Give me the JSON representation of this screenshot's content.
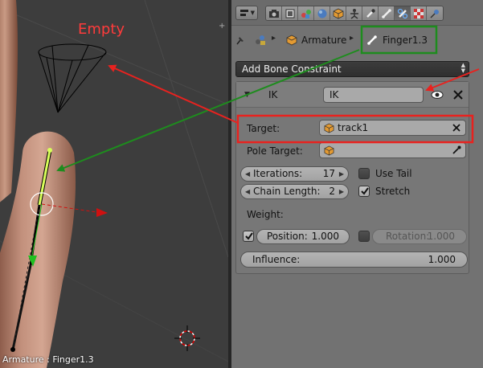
{
  "viewport": {
    "empty_label": "Empty",
    "status_text": "Armature : Finger1.3"
  },
  "header": {
    "editor_type_icon": "editor-type-icon",
    "tabs": [
      {
        "name": "render-tab",
        "icon": "camera-icon",
        "active": false
      },
      {
        "name": "render-layers-tab",
        "icon": "render-layers-icon",
        "active": false
      },
      {
        "name": "scene-tab",
        "icon": "scene-icon",
        "active": false
      },
      {
        "name": "world-tab",
        "icon": "world-icon",
        "active": false
      },
      {
        "name": "object-tab",
        "icon": "object-icon",
        "active": false
      },
      {
        "name": "object-constraints-tab",
        "icon": "object-constraints-icon",
        "active": false
      },
      {
        "name": "modifiers-tab",
        "icon": "wrench-icon",
        "active": false
      },
      {
        "name": "bone-tab",
        "icon": "bone-icon",
        "active": false
      },
      {
        "name": "bone-constraints-tab",
        "icon": "bone-constraint-icon",
        "active": true
      },
      {
        "name": "texture-tab",
        "icon": "texture-icon",
        "active": false
      },
      {
        "name": "physics-tab",
        "icon": "physics-icon",
        "active": false
      }
    ]
  },
  "breadcrumb": {
    "armature": "Armature",
    "bone": "Finger1.3"
  },
  "add_constraint": {
    "label": "Add Bone Constraint"
  },
  "constraint": {
    "type": "IK",
    "name": "IK",
    "target_label": "Target:",
    "target_value": "track1",
    "pole_target_label": "Pole Target:",
    "pole_target_value": "",
    "iterations_label": "Iterations:",
    "iterations_value": "17",
    "chain_length_label": "Chain Length:",
    "chain_length_value": "2",
    "use_tail_label": "Use Tail",
    "use_tail": false,
    "stretch_label": "Stretch",
    "stretch": true,
    "weight_label": "Weight:",
    "position_label": "Position:",
    "position_value": "1.000",
    "position_enabled": true,
    "rotation_label": "Rotation:",
    "rotation_value": "1.000",
    "rotation_enabled": false,
    "influence_label": "Influence:",
    "influence_value": "1.000"
  },
  "colors": {
    "annotation_red": "#e8221f",
    "annotation_green": "#1e8c1e",
    "bone_selected": "#d8ff5a"
  }
}
